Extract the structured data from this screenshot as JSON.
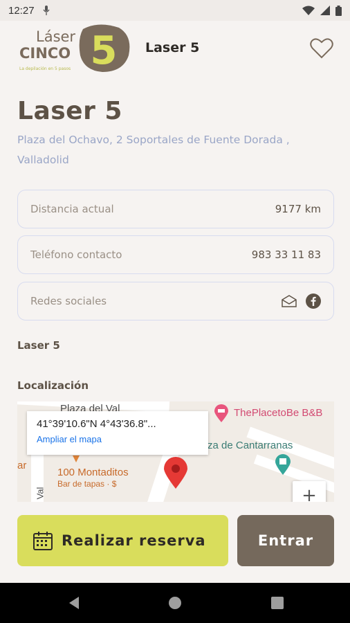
{
  "status_bar": {
    "time": "12:27"
  },
  "header": {
    "title": "Laser 5",
    "logo_text_top": "Láser",
    "logo_text_bottom": "CINCO",
    "logo_number": "5",
    "logo_tagline": "La depilación en 5 pasos"
  },
  "business": {
    "name": "Laser 5",
    "address": "Plaza del Ochavo, 2 Soportales de Fuente Dorada , Valladolid"
  },
  "fields": {
    "distance_label": "Distancia actual",
    "distance_value": "9177 km",
    "phone_label": "Teléfono contacto",
    "phone_value": "983 33 11 83",
    "social_label": "Redes sociales"
  },
  "description": "Laser 5",
  "location_label": "Localización",
  "map": {
    "coords": "41°39'10.6\"N 4°43'36.8\"...",
    "enlarge_link": "Ampliar el mapa",
    "labels": {
      "plaza_val": "Plaza del Val",
      "place_to_be": "ThePlacetoBe B&B",
      "cantarranas": "za de Cantarranas",
      "montaditos": "100 Montaditos",
      "montaditos_sub": "Bar de tapas · $",
      "val": "Val",
      "ar": "ar"
    },
    "zoom_in": "+"
  },
  "buttons": {
    "reserve": "Realizar reserva",
    "enter": "Entrar"
  },
  "colors": {
    "accent_yellow": "#d9dd5c",
    "brown": "#75695c",
    "text_brown": "#5d5246",
    "address_blue": "#9aa6c7"
  }
}
